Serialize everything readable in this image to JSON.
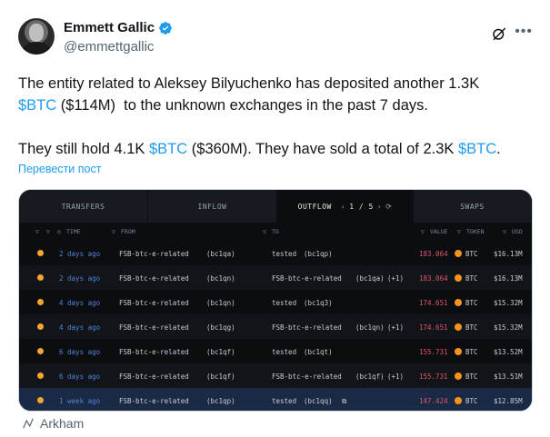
{
  "author": {
    "name": "Emmett Gallic",
    "handle": "@emmettgallic"
  },
  "icons": {
    "verified": "verified-badge-icon",
    "grok": "grok-icon",
    "more": "more-icon",
    "avatar": "avatar"
  },
  "tweet": {
    "line1_a": "The entity related to Aleksey Bilyuchenko has deposited another 1.3K",
    "line2_tag": "$BTC",
    "line2_b": " ($114M)  to the unknown exchanges in the past 7 days.",
    "line3_a": "They still hold 4.1K ",
    "line3_tag1": "$BTC",
    "line3_b": " ($360M). They have sold a total of 2.3K ",
    "line3_tag2": "$BTC",
    "line3_c": "."
  },
  "translate_link": "Перевести пост",
  "card": {
    "tabs": {
      "transfers": "TRANSFERS",
      "inflow": "INFLOW",
      "outflow": "OUTFLOW",
      "page": "1 / 5",
      "swaps": "SWAPS"
    },
    "columns": {
      "time": "TIME",
      "from": "FROM",
      "to": "TO",
      "value": "VALUE",
      "token": "TOKEN",
      "usd": "USD"
    },
    "rows": [
      {
        "time": "2 days ago",
        "from": "FSB-btc-e-related",
        "from_addr": "(bc1qa)",
        "to": "tested",
        "to_addr": "(bc1qp)",
        "to_extra": "",
        "value": "183.064",
        "token": "BTC",
        "usd": "$16.13M"
      },
      {
        "time": "2 days ago",
        "from": "FSB-btc-e-related",
        "from_addr": "(bc1qn)",
        "to": "FSB-btc-e-related",
        "to_addr": "(bc1qa)",
        "to_extra": "(+1)",
        "value": "183.064",
        "token": "BTC",
        "usd": "$16.13M"
      },
      {
        "time": "4 days ago",
        "from": "FSB-btc-e-related",
        "from_addr": "(bc1qn)",
        "to": "tested",
        "to_addr": "(bc1q3)",
        "to_extra": "",
        "value": "174.651",
        "token": "BTC",
        "usd": "$15.32M"
      },
      {
        "time": "4 days ago",
        "from": "FSB-btc-e-related",
        "from_addr": "(bc1qg)",
        "to": "FSB-btc-e-related",
        "to_addr": "(bc1qn)",
        "to_extra": "(+1)",
        "value": "174.651",
        "token": "BTC",
        "usd": "$15.32M"
      },
      {
        "time": "6 days ago",
        "from": "FSB-btc-e-related",
        "from_addr": "(bc1qf)",
        "to": "tested",
        "to_addr": "(bc1qt)",
        "to_extra": "",
        "value": "155.731",
        "token": "BTC",
        "usd": "$13.52M"
      },
      {
        "time": "6 days ago",
        "from": "FSB-btc-e-related",
        "from_addr": "(bc1qf)",
        "to": "FSB-btc-e-related",
        "to_addr": "(bc1qf)",
        "to_extra": "(+1)",
        "value": "155.731",
        "token": "BTC",
        "usd": "$13.51M"
      },
      {
        "time": "1 week ago",
        "from": "FSB-btc-e-related",
        "from_addr": "(bc1qp)",
        "to": "tested",
        "to_addr": "(bc1qq)",
        "to_extra": "",
        "value": "147.424",
        "token": "BTC",
        "usd": "$12.85M"
      }
    ]
  },
  "footer": {
    "source": "Arkham"
  },
  "colors": {
    "accent": "#1d9bf0",
    "btc": "#f7931a",
    "value_red": "#e0556b",
    "time_blue": "#4e84d9"
  }
}
